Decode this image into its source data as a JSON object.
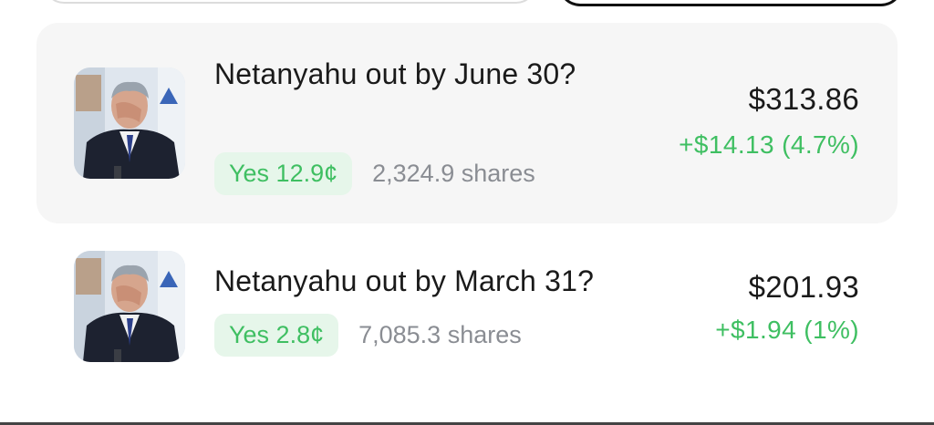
{
  "positions": [
    {
      "title": "Netanyahu out by June 30?",
      "outcome": "Yes 12.9¢",
      "shares": "2,324.9 shares",
      "value": "$313.86",
      "change": "+$14.13 (4.7%)",
      "thumbnail_icon": "person-photo"
    },
    {
      "title": "Netanyahu out by March 31?",
      "outcome": "Yes 2.8¢",
      "shares": "7,085.3 shares",
      "value": "$201.93",
      "change": "+$1.94 (1%)",
      "thumbnail_icon": "person-photo"
    }
  ],
  "colors": {
    "positive": "#3fbf62",
    "pill_bg": "#e6f6ea",
    "card_bg": "#f6f6f6"
  }
}
